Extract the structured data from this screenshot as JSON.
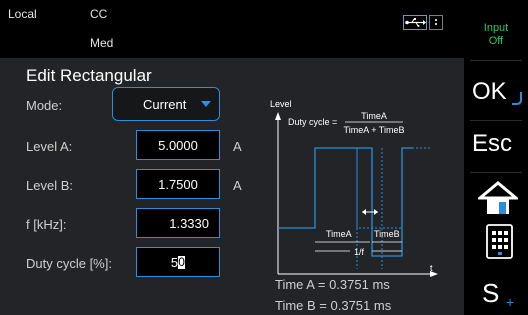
{
  "status": {
    "mode": "Local",
    "function": "CC",
    "range": "Med"
  },
  "output": {
    "line1": "Input",
    "line2": "Off"
  },
  "title": "Edit Rectangular",
  "fields": {
    "mode": {
      "label": "Mode:",
      "value": "Current"
    },
    "level_a": {
      "label": "Level A:",
      "value": "5.0000",
      "unit": "A"
    },
    "level_b": {
      "label": "Level B:",
      "value": "1.7500",
      "unit": "A"
    },
    "freq": {
      "label": "f [kHz]:",
      "value": "1.3330"
    },
    "duty": {
      "label": "Duty cycle [%]:",
      "value": "5",
      "editing_char": "0"
    }
  },
  "diagram": {
    "y_axis": "Level",
    "duty_prefix": "Duty cycle =",
    "numerator": "TimeA",
    "denominator": "TimeA + TimeB",
    "time_a": "TimeA",
    "time_b": "TimeB",
    "period": "1/f",
    "t_axis": "t"
  },
  "time_a_text": "Time A = 0.3751 ms",
  "time_b_text": "Time B = 0.3751 ms",
  "softkeys": {
    "ok": "OK",
    "esc": "Esc",
    "s": "S"
  },
  "colors": {
    "accent": "#2a8fd8",
    "panel": "#222427",
    "input_off": "#29c76a"
  }
}
